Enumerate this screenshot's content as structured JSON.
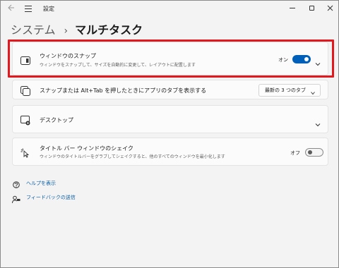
{
  "window": {
    "title": "設定"
  },
  "breadcrumb": {
    "parent": "システム",
    "separator": "›",
    "current": "マルチタスク"
  },
  "snap": {
    "label": "ウィンドウのスナップ",
    "description": "ウィンドウをスナップして、サイズを自動的に変更して、レイアウトに配置します",
    "state_label": "オン",
    "enabled": true
  },
  "alt_tab": {
    "label": "スナップまたは Alt+Tab を押したときにアプリのタブを表示する",
    "selected_option": "最新の 3 つのタブ"
  },
  "desktops": {
    "label": "デスクトップ"
  },
  "shake": {
    "label": "タイトル バー ウィンドウのシェイク",
    "description": "ウィンドウのタイトルバーをグラブしてシェイクすると、他のすべてのウィンドウを最小化します",
    "state_label": "オフ",
    "enabled": false
  },
  "links": {
    "help": "ヘルプを表示",
    "feedback": "フィードバックの送信"
  },
  "colors": {
    "accent": "#005fb8",
    "highlight": "#e3181f",
    "link": "#0a5ea8"
  }
}
